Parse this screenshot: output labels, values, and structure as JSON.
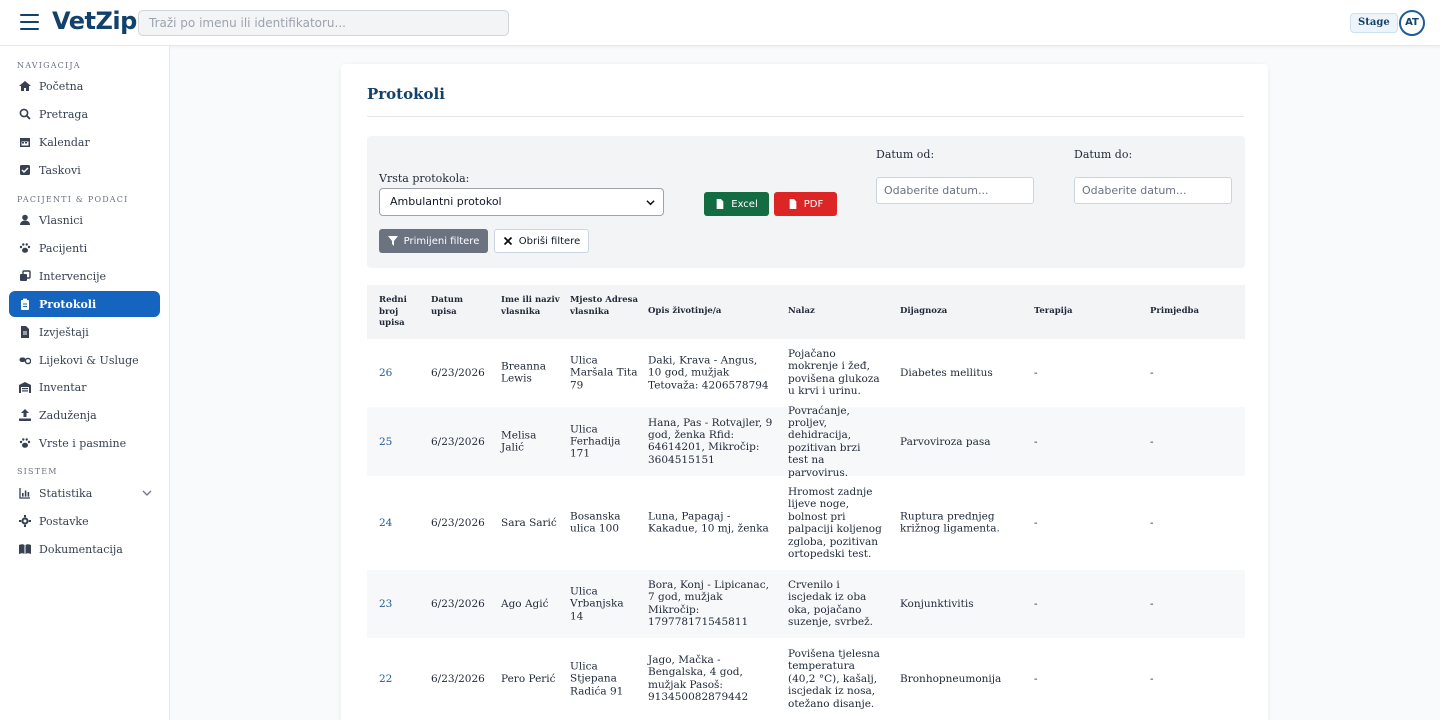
{
  "header": {
    "logo": "VetZip",
    "search_placeholder": "Traži po imenu ili identifikatoru...",
    "env_badge": "Stage",
    "avatar": "AT"
  },
  "sidebar": {
    "sections": [
      "NAVIGACIJA",
      "PACIJENTI & PODACI",
      "SISTEM"
    ],
    "items": [
      {
        "label": "Početna",
        "icon": "home-icon"
      },
      {
        "label": "Pretraga",
        "icon": "search-icon"
      },
      {
        "label": "Kalendar",
        "icon": "calendar-icon"
      },
      {
        "label": "Taskovi",
        "icon": "check-square-icon"
      },
      {
        "label": "Vlasnici",
        "icon": "user-icon"
      },
      {
        "label": "Pacijenti",
        "icon": "paw-icon"
      },
      {
        "label": "Intervencije",
        "icon": "clone-icon"
      },
      {
        "label": "Protokoli",
        "icon": "clipboard-icon",
        "active": true
      },
      {
        "label": "Izvještaji",
        "icon": "file-icon"
      },
      {
        "label": "Lijekovi & Usluge",
        "icon": "pills-icon"
      },
      {
        "label": "Inventar",
        "icon": "warehouse-icon"
      },
      {
        "label": "Zaduženja",
        "icon": "upload-icon"
      },
      {
        "label": "Vrste i pasmine",
        "icon": "paw-icon"
      },
      {
        "label": "Statistika",
        "icon": "chart-icon",
        "expandable": true
      },
      {
        "label": "Postavke",
        "icon": "gear-icon"
      },
      {
        "label": "Dokumentacija",
        "icon": "book-icon"
      }
    ]
  },
  "main": {
    "title": "Protokoli",
    "filters": {
      "type_label": "Vrsta protokola:",
      "type_value": "Ambulantni protokol",
      "excel_label": "Excel",
      "pdf_label": "PDF",
      "apply_label": "Primijeni filtere",
      "clear_label": "Obriši filtere",
      "date_from_label": "Datum od:",
      "date_to_label": "Datum do:",
      "date_placeholder": "Odaberite datum..."
    },
    "table": {
      "columns": [
        "Redni broj upisa",
        "Datum upisa",
        "Ime ili naziv vlasnika",
        "Mjesto Adresa vlasnika",
        "Opis životinje/a",
        "Nalaz",
        "Dijagnoza",
        "Terapija",
        "Primjedba"
      ],
      "rows": [
        [
          "26",
          "6/23/2026",
          "Breanna Lewis",
          "Ulica Maršala Tita 79",
          "Daki, Krava - Angus, 10 god, mužjak Tetovaža: 4206578794",
          "Pojačano mokrenje i žeđ, povišena glukoza u krvi i urinu.",
          "Diabetes mellitus",
          "-",
          "-"
        ],
        [
          "25",
          "6/23/2026",
          "Melisa Jalić",
          "Ulica Ferhadija 171",
          "Hana, Pas - Rotvajler, 9 god, ženka Rfid: 64614201, Mikročip: 3604515151",
          "Povraćanje, proljev, dehidracija, pozitivan brzi test na parvovirus.",
          "Parvoviroza pasa",
          "-",
          "-"
        ],
        [
          "24",
          "6/23/2026",
          "Sara Sarić",
          "Bosanska ulica 100",
          "Luna, Papagaj - Kakadue, 10 mj, ženka",
          "Hromost zadnje lijeve noge, bolnost pri palpaciji koljenog zgloba, pozitivan ortopedski test.",
          "Ruptura prednjeg križnog ligamenta.",
          "-",
          "-"
        ],
        [
          "23",
          "6/23/2026",
          "Ago Agić",
          "Ulica Vrbanjska 14",
          "Bora, Konj - Lipicanac, 7 god, mužjak Mikročip: 179778171545811",
          "Crvenilo i iscjedak iz oba oka, pojačano suzenje, svrbež.",
          "Konjunktivitis",
          "-",
          "-"
        ],
        [
          "22",
          "6/23/2026",
          "Pero Perić",
          "Ulica Stjepana Radića 91",
          "Jago, Mačka - Bengalska, 4 god, mužjak Pasoš: 913450082879442",
          "Povišena tjelesna temperatura (40,2 °C), kašalj, iscjedak iz nosa, otežano disanje.",
          "Bronhopneumonija",
          "-",
          "-"
        ]
      ]
    }
  }
}
